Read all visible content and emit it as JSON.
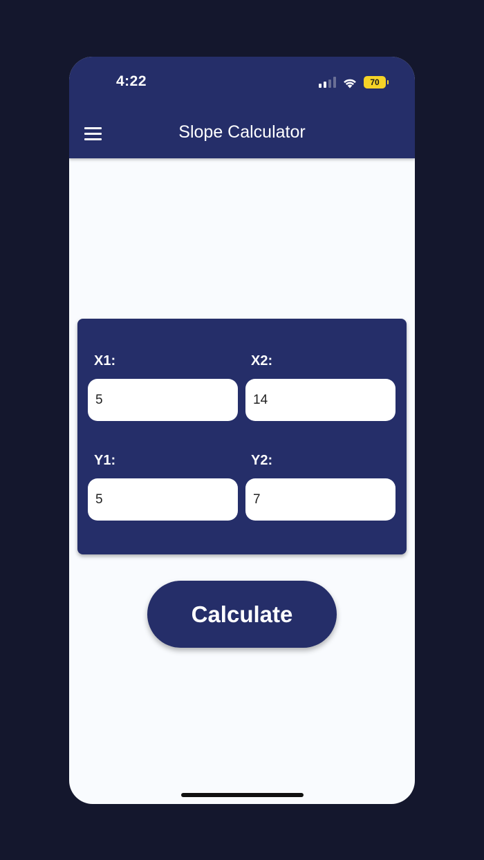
{
  "status_bar": {
    "time": "4:22",
    "battery": "70",
    "signal_icon": "cellular-signal-icon",
    "wifi_icon": "wifi-icon"
  },
  "app_bar": {
    "title": "Slope Calculator",
    "menu_icon": "hamburger-menu-icon"
  },
  "form": {
    "x1": {
      "label": "X1:",
      "value": "5"
    },
    "x2": {
      "label": "X2:",
      "value": "14"
    },
    "y1": {
      "label": "Y1:",
      "value": "5"
    },
    "y2": {
      "label": "Y2:",
      "value": "7"
    }
  },
  "actions": {
    "calculate_label": "Calculate"
  },
  "colors": {
    "background": "#14172d",
    "primary": "#252e69",
    "surface": "#f9fbfe",
    "battery": "#f5d327"
  }
}
